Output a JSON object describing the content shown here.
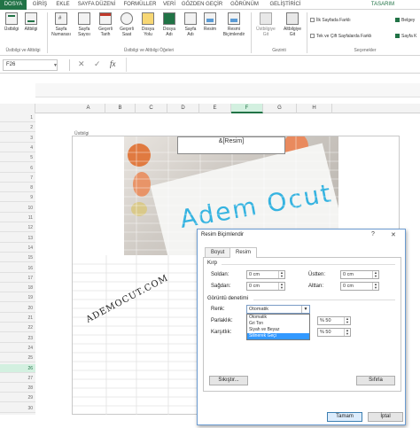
{
  "ribbon_tabs": {
    "file": "DOSYA",
    "home": "GİRİŞ",
    "insert": "EKLE",
    "layout": "SAYFA DÜZENİ",
    "formulas": "FORMÜLLER",
    "data": "VERİ",
    "review": "GÖZDEN GEÇİR",
    "view": "GÖRÜNÜM",
    "developer": "GELİŞTİRİCİ",
    "design": "TASARIM"
  },
  "ribbon": {
    "header": "Üstbilgi",
    "footer": "Altbilgi",
    "page_number_1": "Sayfa",
    "page_number_2": "Numarası",
    "page_count_1": "Sayfa",
    "page_count_2": "Sayısı",
    "current_date_1": "Geçerli",
    "current_date_2": "Tarih",
    "current_time_1": "Geçerli",
    "current_time_2": "Saat",
    "file_path_1": "Dosya",
    "file_path_2": "Yolu",
    "file_name_1": "Dosya",
    "file_name_2": "Adı",
    "sheet_name_1": "Sayfa",
    "sheet_name_2": "Adı",
    "picture": "Resim",
    "format_picture_1": "Resmi",
    "format_picture_2": "Biçimlendir",
    "goto_header_1": "Üstbilgiye",
    "goto_header_2": "Git",
    "goto_footer_1": "Altbilgiye",
    "goto_footer_2": "Git",
    "group_hf": "Üstbilgi ve Altbilgi",
    "group_elements": "Üstbilgi ve Altbilgi Öğeleri",
    "group_nav": "Gezinti",
    "group_options": "Seçenekler",
    "opt_first_page": "İlk Sayfada Farklı",
    "opt_odd_even": "Tek ve Çift Sayfalarda Farklı",
    "opt_scale_1": "Belgey",
    "opt_scale_2": "Sayfa K"
  },
  "formula_bar": {
    "name_box": "F26",
    "cancel_symbol": "✕",
    "enter_symbol": "✓",
    "fx_symbol": "fx"
  },
  "columns": [
    "A",
    "B",
    "C",
    "D",
    "E",
    "F",
    "G",
    "H"
  ],
  "selected_column": "F",
  "rows": [
    "1",
    "2",
    "3",
    "4",
    "5",
    "6",
    "7",
    "8",
    "9",
    "10",
    "11",
    "12",
    "13",
    "14",
    "15",
    "16",
    "17",
    "18",
    "19",
    "20",
    "21",
    "22",
    "23",
    "24",
    "25",
    "26",
    "27",
    "28",
    "29",
    "30"
  ],
  "selected_row": "26",
  "page": {
    "header_label": "Üstbilgi",
    "header_field": "&[Resim]",
    "watermark_text": "Adem Ocut",
    "stamp_text": "ADEMOCUT.COM"
  },
  "dialog": {
    "title": "Resim Biçimlendir",
    "help_symbol": "?",
    "close_symbol": "✕",
    "tab_size": "Boyut",
    "tab_picture": "Resim",
    "crop_section": "Kırp",
    "left_label": "Soldan:",
    "left_value": "0 cm",
    "right_label": "Sağdan:",
    "right_value": "0 cm",
    "top_label": "Üstten:",
    "top_value": "0 cm",
    "bottom_label": "Alttan:",
    "bottom_value": "0 cm",
    "image_control_section": "Görüntü denetimi",
    "color_label": "Renk:",
    "color_value": "Otomatik",
    "color_options": [
      "Otomatik",
      "Gri Ton",
      "Siyah ve Beyaz",
      "Silinerek Geçi"
    ],
    "color_selected_index": 3,
    "brightness_label": "Parlaklık:",
    "brightness_value": "% 50",
    "contrast_label": "Karşıtlık:",
    "contrast_value": "% 50",
    "compress_button": "Sıkıştır...",
    "reset_button": "Sıfırla",
    "ok_button": "Tamam",
    "cancel_button": "İptal"
  },
  "colors": {
    "excel_green": "#217346",
    "selected_header": "#d3f0e0",
    "list_highlight": "#3399ff",
    "watermark_blue": "#35b3e0"
  }
}
